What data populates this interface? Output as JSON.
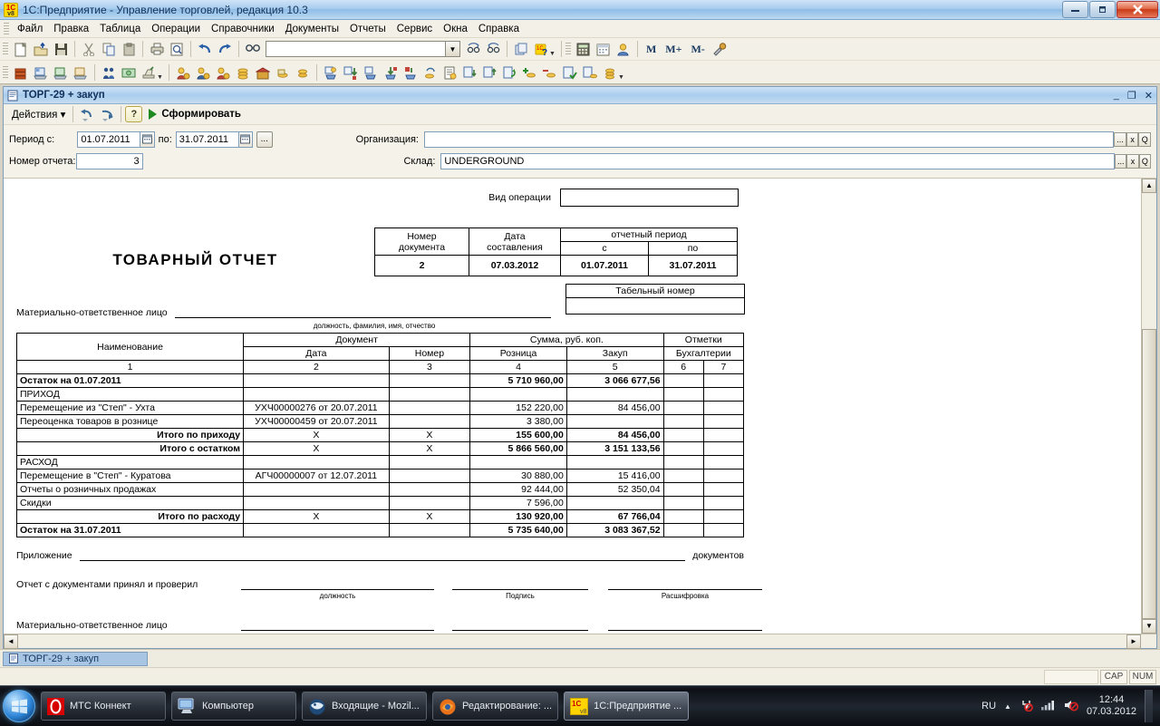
{
  "window": {
    "title": "1С:Предприятие - Управление торговлей, редакция 10.3",
    "app_icon": "1c-logo-icon",
    "minimize": "—",
    "maximize": "❐",
    "close": "✕"
  },
  "menubar": {
    "items": [
      "Файл",
      "Правка",
      "Таблица",
      "Операции",
      "Справочники",
      "Документы",
      "Отчеты",
      "Сервис",
      "Окна",
      "Справка"
    ]
  },
  "toolbar_row1": {
    "combo_value": "",
    "memory_buttons": [
      "M",
      "M+",
      "M-"
    ],
    "icons": [
      "new-document-icon",
      "open-folder-icon",
      "save-icon",
      "cut-icon",
      "copy-icon",
      "paste-icon",
      "print-icon",
      "print-preview-icon",
      "undo-icon",
      "redo-icon",
      "find-icon",
      "search-next-icon",
      "search-prev-icon",
      "copy-window-icon",
      "help-1c-icon",
      "calculator-icon",
      "calendar-icon",
      "user-icon",
      "settings-tools-icon"
    ]
  },
  "toolbar_row2": {
    "icons": [
      "catalog-books-icon",
      "price-list-icon",
      "document-list-icon",
      "journal-icon",
      "counterparties-icon",
      "cash-icon",
      "cash-register-icon",
      "sales-person-icon",
      "purchase-person-icon",
      "client-person-icon",
      "coins-icon",
      "warehouse-icon",
      "money-stack-icon",
      "gold-coins-icon",
      "receipt-cart-icon",
      "goods-in-icon",
      "basket-icon",
      "goods-out-icon",
      "transfer-icon",
      "coins-circle-icon",
      "report-doc-icon",
      "invoice-in-icon",
      "invoice-out-icon",
      "refresh-doc-icon",
      "add-coins-icon",
      "remove-coins-icon",
      "check-doc-icon",
      "stack-doc-icon",
      "coin-stack-icon"
    ]
  },
  "document_window": {
    "title": "ТОРГ-29 + закуп",
    "icon": "report-window-icon",
    "minimize": "_",
    "restore": "❐",
    "close": "✕",
    "toolbar": {
      "actions_label": "Действия",
      "actions_caret": "▾",
      "undo_icon": "undo-arrow-icon",
      "redo_icon": "redo-arrow-icon",
      "help_label": "?",
      "generate_label": "Сформировать"
    },
    "params": {
      "period_label": "Период с:",
      "period_from": "01.07.2011",
      "period_to_label": "по:",
      "period_to": "31.07.2011",
      "ellipsis_label": "...",
      "report_no_label": "Номер отчета:",
      "report_no": "3",
      "organization_label": "Организация:",
      "organization_value": "",
      "warehouse_label": "Склад:",
      "warehouse_value": "UNDERGROUND",
      "select_btn": "...",
      "clear_btn": "x",
      "open_btn": "Q"
    }
  },
  "report": {
    "operation_type_label": "Вид операции",
    "operation_type_value": "",
    "title": "ТОВАРНЫЙ ОТЧЕТ",
    "doc_header": {
      "col_number": "Номер",
      "col_number2": "документа",
      "col_date": "Дата",
      "col_date2": "составления",
      "col_period": "отчетный период",
      "col_from": "с",
      "col_to": "по",
      "number_value": "2",
      "date_value": "07.03.2012",
      "from_value": "01.07.2011",
      "to_value": "31.07.2011"
    },
    "responsible_label": "Материально-ответственное лицо",
    "responsible_hint": "должность, фамилия, имя, отчество",
    "personnel_no_label": "Табельный номер",
    "personnel_no_value": "",
    "table": {
      "headers": {
        "name": "Наименование",
        "document": "Документ",
        "doc_date": "Дата",
        "doc_number": "Номер",
        "amount": "Сумма, руб. коп.",
        "retail": "Розница",
        "purchase": "Закуп",
        "marks": "Отметки",
        "accounting": "Бухгалтерии"
      },
      "numbering": [
        "1",
        "2",
        "3",
        "4",
        "5",
        "6",
        "7"
      ],
      "rows": [
        {
          "name": "Остаток на 01.07.2011",
          "date": "",
          "number": "",
          "retail": "5 710 960,00",
          "purchase": "3 066 677,56",
          "m6": "",
          "m7": "",
          "bold": true,
          "align": "left"
        },
        {
          "name": "ПРИХОД",
          "date": "",
          "number": "",
          "retail": "",
          "purchase": "",
          "m6": "",
          "m7": "",
          "bold": false,
          "align": "left"
        },
        {
          "name": "Перемещение из \"Степ\" - Ухта",
          "date": "УХЧ00000276 от 20.07.2011",
          "number": "",
          "retail": "152 220,00",
          "purchase": "84 456,00",
          "m6": "",
          "m7": "",
          "bold": false,
          "align": "left"
        },
        {
          "name": "Переоценка товаров в рознице",
          "date": "УХЧ00000459 от 20.07.2011",
          "number": "",
          "retail": "3 380,00",
          "purchase": "",
          "m6": "",
          "m7": "",
          "bold": false,
          "align": "left"
        },
        {
          "name": "Итого по приходу",
          "date": "X",
          "number": "X",
          "retail": "155 600,00",
          "purchase": "84 456,00",
          "m6": "",
          "m7": "",
          "bold": true,
          "align": "right"
        },
        {
          "name": "Итого с остатком",
          "date": "X",
          "number": "X",
          "retail": "5 866 560,00",
          "purchase": "3 151 133,56",
          "m6": "",
          "m7": "",
          "bold": true,
          "align": "right"
        },
        {
          "name": "РАСХОД",
          "date": "",
          "number": "",
          "retail": "",
          "purchase": "",
          "m6": "",
          "m7": "",
          "bold": false,
          "align": "left"
        },
        {
          "name": "Перемещение в \"Степ\" - Куратова",
          "date": "АГЧ00000007 от 12.07.2011",
          "number": "",
          "retail": "30 880,00",
          "purchase": "15 416,00",
          "m6": "",
          "m7": "",
          "bold": false,
          "align": "left"
        },
        {
          "name": "Отчеты о розничных продажах",
          "date": "",
          "number": "",
          "retail": "92 444,00",
          "purchase": "52 350,04",
          "m6": "",
          "m7": "",
          "bold": false,
          "align": "left"
        },
        {
          "name": "Скидки",
          "date": "",
          "number": "",
          "retail": "7 596,00",
          "purchase": "",
          "m6": "",
          "m7": "",
          "bold": false,
          "align": "left"
        },
        {
          "name": "Итого по расходу",
          "date": "X",
          "number": "X",
          "retail": "130 920,00",
          "purchase": "67 766,04",
          "m6": "",
          "m7": "",
          "bold": true,
          "align": "right"
        },
        {
          "name": "Остаток на 31.07.2011",
          "date": "",
          "number": "",
          "retail": "5 735 640,00",
          "purchase": "3 083 367,52",
          "m6": "",
          "m7": "",
          "bold": true,
          "align": "left"
        }
      ]
    },
    "footer": {
      "appendix_label": "Приложение",
      "appendix_suffix": "документов",
      "accepted_label": "Отчет с документами принял и проверил",
      "hint_position": "должность",
      "hint_signature": "Подпись",
      "hint_decode": "Расшифровка",
      "responsible_label": "Материально-ответственное лицо"
    }
  },
  "window_tabs": {
    "items": [
      {
        "label": "ТОРГ-29 + закуп",
        "icon": "report-window-icon",
        "active": true
      }
    ]
  },
  "statusbar": {
    "caps": "CAP",
    "num": "NUM"
  },
  "taskbar": {
    "start_icon": "windows-start-orb-icon",
    "buttons": [
      {
        "label": "МТС Коннект",
        "icon": "mts-connect-icon",
        "active": false
      },
      {
        "label": "Компьютер",
        "icon": "computer-icon",
        "active": false
      },
      {
        "label": "Входящие - Mozil...",
        "icon": "thunderbird-icon",
        "active": false
      },
      {
        "label": "Редактирование: ...",
        "icon": "firefox-icon",
        "active": false
      },
      {
        "label": "1С:Предприятие ...",
        "icon": "1c-logo-icon",
        "active": true
      }
    ],
    "tray": {
      "language": "RU",
      "show_hidden_icon": "chevron-up-icon",
      "power_icon": "power-plug-icon",
      "network_icon": "network-signal-icon",
      "volume_icon": "volume-muted-icon",
      "time": "12:44",
      "date": "07.03.2012"
    }
  },
  "colors": {
    "titlebar_blue": "#a8cdee",
    "toolbar_bg": "#f3f1e7",
    "panel_bg": "#f5f3e9",
    "sheet_bg": "#ffffff",
    "taskbar_dark": "#10141a",
    "accent_green": "#1f8a1f",
    "close_red": "#c83a17"
  }
}
